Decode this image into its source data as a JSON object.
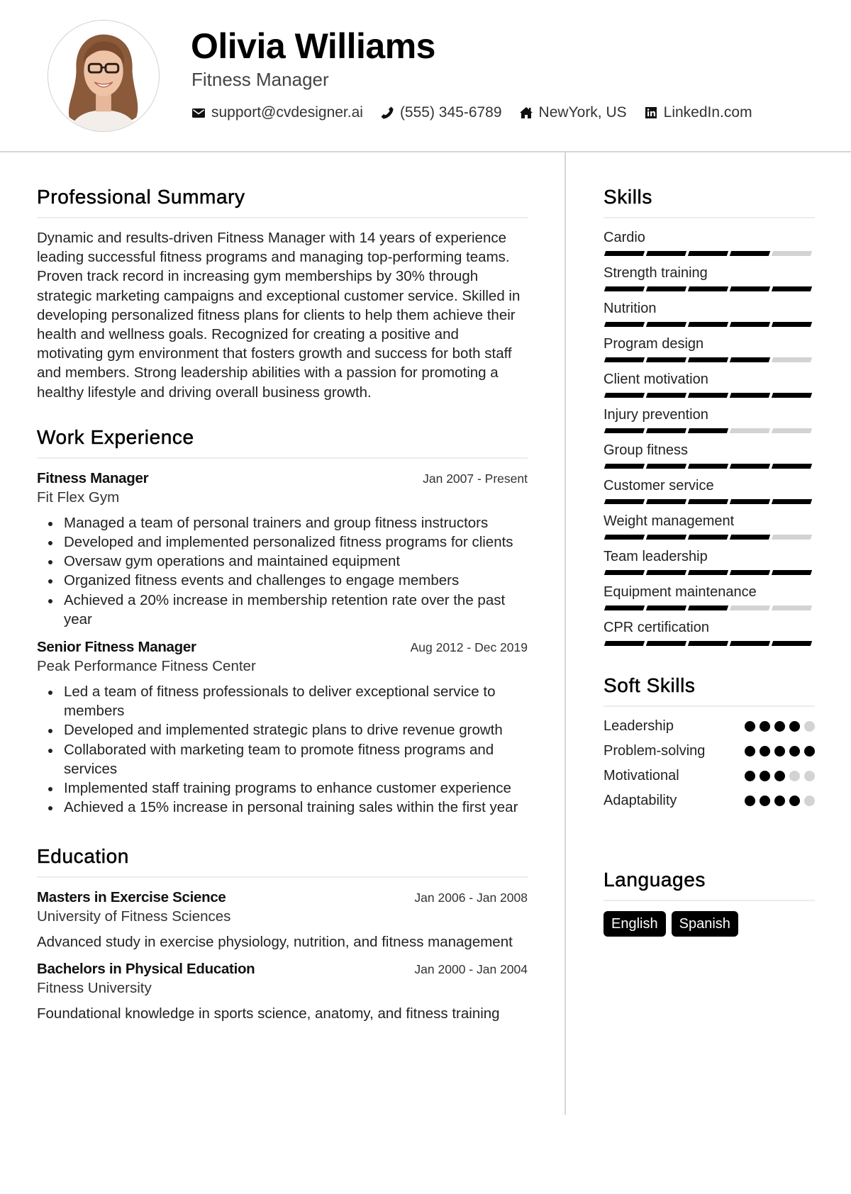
{
  "header": {
    "name": "Olivia Williams",
    "title": "Fitness Manager",
    "photo_icon": "profile-photo",
    "contacts": [
      {
        "icon": "envelope-icon",
        "text": "support@cvdesigner.ai"
      },
      {
        "icon": "phone-icon",
        "text": "(555) 345-6789"
      },
      {
        "icon": "home-icon",
        "text": "NewYork, US"
      },
      {
        "icon": "linkedin-icon",
        "text": "LinkedIn.com"
      }
    ]
  },
  "summary": {
    "heading": "Professional Summary",
    "text": "Dynamic and results-driven Fitness Manager with 14 years of experience leading successful fitness programs and managing top-performing teams. Proven track record in increasing gym memberships by 30% through strategic marketing campaigns and exceptional customer service. Skilled in developing personalized fitness plans for clients to help them achieve their health and wellness goals. Recognized for creating a positive and motivating gym environment that fosters growth and success for both staff and members. Strong leadership abilities with a passion for promoting a healthy lifestyle and driving overall business growth."
  },
  "experience": {
    "heading": "Work Experience",
    "jobs": [
      {
        "title": "Fitness Manager",
        "dates": "Jan 2007 - Present",
        "company": "Fit Flex Gym",
        "bullets": [
          "Managed a team of personal trainers and group fitness instructors",
          "Developed and implemented personalized fitness programs for clients",
          "Oversaw gym operations and maintained equipment",
          "Organized fitness events and challenges to engage members",
          "Achieved a 20% increase in membership retention rate over the past year"
        ]
      },
      {
        "title": "Senior Fitness Manager",
        "dates": "Aug 2012 - Dec 2019",
        "company": "Peak Performance Fitness Center",
        "bullets": [
          "Led a team of fitness professionals to deliver exceptional service to members",
          "Developed and implemented strategic plans to drive revenue growth",
          "Collaborated with marketing team to promote fitness programs and services",
          "Implemented staff training programs to enhance customer experience",
          "Achieved a 15% increase in personal training sales within the first year"
        ]
      }
    ]
  },
  "education": {
    "heading": "Education",
    "items": [
      {
        "degree": "Masters in Exercise Science",
        "dates": "Jan 2006 - Jan 2008",
        "school": "University of Fitness Sciences",
        "description": "Advanced study in exercise physiology, nutrition, and fitness management"
      },
      {
        "degree": "Bachelors in Physical Education",
        "dates": "Jan 2000 - Jan 2004",
        "school": "Fitness University",
        "description": "Foundational knowledge in sports science, anatomy, and fitness training"
      }
    ]
  },
  "skills": {
    "heading": "Skills",
    "max_level": 5,
    "items": [
      {
        "label": "Cardio",
        "level": 4
      },
      {
        "label": "Strength training",
        "level": 5
      },
      {
        "label": "Nutrition",
        "level": 5
      },
      {
        "label": "Program design",
        "level": 4
      },
      {
        "label": "Client motivation",
        "level": 5
      },
      {
        "label": "Injury prevention",
        "level": 3
      },
      {
        "label": "Group fitness",
        "level": 5
      },
      {
        "label": "Customer service",
        "level": 5
      },
      {
        "label": "Weight management",
        "level": 4
      },
      {
        "label": "Team leadership",
        "level": 5
      },
      {
        "label": "Equipment maintenance",
        "level": 3
      },
      {
        "label": "CPR certification",
        "level": 5
      }
    ]
  },
  "soft_skills": {
    "heading": "Soft Skills",
    "max_level": 5,
    "items": [
      {
        "label": "Leadership",
        "level": 4
      },
      {
        "label": "Problem-solving",
        "level": 5
      },
      {
        "label": "Motivational",
        "level": 3
      },
      {
        "label": "Adaptability",
        "level": 4
      }
    ]
  },
  "languages": {
    "heading": "Languages",
    "items": [
      "English",
      "Spanish"
    ]
  },
  "colors": {
    "text": "#222222",
    "accent": "#000000",
    "inactive": "#d3d3d3",
    "rule": "#d6d6d6"
  }
}
